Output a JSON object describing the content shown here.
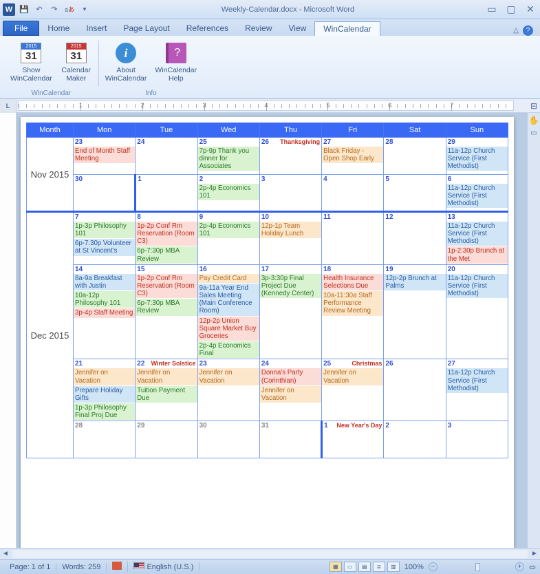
{
  "app": {
    "title": "Weekly-Calendar.docx - Microsoft Word"
  },
  "tabs": {
    "file": "File",
    "items": [
      "Home",
      "Insert",
      "Page Layout",
      "References",
      "Review",
      "View",
      "WinCalendar"
    ],
    "active": "WinCalendar"
  },
  "ribbon": {
    "group1_label": "WinCalendar",
    "btn_show": "Show\nWinCalendar",
    "btn_maker": "Calendar\nMaker",
    "group2_label": "Info",
    "btn_about": "About\nWinCalendar",
    "btn_help": "WinCalendar\nHelp"
  },
  "ruler": {
    "nums": [
      "1",
      "2",
      "3",
      "4",
      "5",
      "6",
      "7"
    ]
  },
  "cal_header": [
    "Month",
    "Mon",
    "Tue",
    "Wed",
    "Thu",
    "Fri",
    "Sat",
    "Sun"
  ],
  "months": {
    "m1": "Nov 2015",
    "m2": "Dec 2015"
  },
  "rows": [
    {
      "days": [
        {
          "n": "23",
          "cls": "",
          "evts": [
            {
              "c": "red",
              "t": "End of Month Staff Meeting"
            }
          ]
        },
        {
          "n": "24",
          "cls": "",
          "evts": []
        },
        {
          "n": "25",
          "cls": "",
          "evts": [
            {
              "c": "green",
              "t": "7p-9p Thank you dinner for Associates"
            }
          ]
        },
        {
          "n": "26",
          "cls": "",
          "hol": "Thanksgiving",
          "evts": []
        },
        {
          "n": "27",
          "cls": "",
          "evts": [
            {
              "c": "peach",
              "t": "Black Friday - Open Shop Early"
            }
          ]
        },
        {
          "n": "28",
          "cls": "",
          "evts": []
        },
        {
          "n": "29",
          "cls": "",
          "evts": [
            {
              "c": "blue",
              "t": "11a-12p Church Service (First Methodist)"
            }
          ]
        }
      ]
    },
    {
      "days": [
        {
          "n": "30",
          "cls": "",
          "evts": []
        },
        {
          "n": "1",
          "cls": "thick-left",
          "evts": []
        },
        {
          "n": "2",
          "cls": "",
          "evts": [
            {
              "c": "green",
              "t": "2p-4p Economics 101"
            }
          ]
        },
        {
          "n": "3",
          "cls": "",
          "evts": []
        },
        {
          "n": "4",
          "cls": "",
          "evts": []
        },
        {
          "n": "5",
          "cls": "",
          "evts": []
        },
        {
          "n": "6",
          "cls": "",
          "evts": [
            {
              "c": "blue",
              "t": "11a-12p Church Service (First Methodist)"
            }
          ]
        }
      ]
    },
    {
      "thick": true,
      "days": [
        {
          "n": "7",
          "cls": "",
          "evts": [
            {
              "c": "green",
              "t": "1p-3p Philosophy 101"
            },
            {
              "c": "blue",
              "t": "6p-7:30p Volunteer at St Vincent's"
            }
          ]
        },
        {
          "n": "8",
          "cls": "",
          "evts": [
            {
              "c": "red",
              "t": "1p-2p Conf Rm Reservation (Room C3)"
            },
            {
              "c": "green",
              "t": "6p-7:30p MBA Review"
            }
          ]
        },
        {
          "n": "9",
          "cls": "",
          "evts": [
            {
              "c": "green",
              "t": "2p-4p Economics 101"
            }
          ]
        },
        {
          "n": "10",
          "cls": "",
          "evts": [
            {
              "c": "peach",
              "t": "12p-1p Team Holiday Lunch"
            }
          ]
        },
        {
          "n": "11",
          "cls": "",
          "evts": []
        },
        {
          "n": "12",
          "cls": "",
          "evts": []
        },
        {
          "n": "13",
          "cls": "",
          "evts": [
            {
              "c": "blue",
              "t": "11a-12p Church Service (First Methodist)"
            },
            {
              "c": "red",
              "t": "1p-2:30p Brunch at the Met"
            }
          ]
        }
      ]
    },
    {
      "days": [
        {
          "n": "14",
          "cls": "",
          "evts": [
            {
              "c": "blue",
              "t": "8a-9a Breakfast with Justin"
            },
            {
              "c": "green",
              "t": "10a-12p Philosophy 101"
            },
            {
              "c": "red",
              "t": "3p-4p Staff Meeting"
            }
          ]
        },
        {
          "n": "15",
          "cls": "",
          "evts": [
            {
              "c": "red",
              "t": "1p-2p Conf Rm Reservation (Room C3)"
            },
            {
              "c": "green",
              "t": "6p-7:30p MBA Review"
            }
          ]
        },
        {
          "n": "16",
          "cls": "",
          "evts": [
            {
              "c": "peach",
              "t": "Pay Credit Card"
            },
            {
              "c": "blue",
              "t": "9a-11a Year End Sales Meeting (Main Conference Room)"
            },
            {
              "c": "red",
              "t": "12p-2p Union Square Market Buy Groceries"
            },
            {
              "c": "green",
              "t": "2p-4p Economics Final"
            }
          ]
        },
        {
          "n": "17",
          "cls": "",
          "evts": [
            {
              "c": "green",
              "t": "3p-3:30p Final Project Due (Kennedy Center)"
            }
          ]
        },
        {
          "n": "18",
          "cls": "",
          "evts": [
            {
              "c": "red",
              "t": "Health Insurance Selections Due"
            },
            {
              "c": "peach",
              "t": "10a-11:30a Staff Performance Review Meeting"
            }
          ]
        },
        {
          "n": "19",
          "cls": "",
          "evts": [
            {
              "c": "blue",
              "t": "12p-2p Brunch at Palms"
            }
          ]
        },
        {
          "n": "20",
          "cls": "",
          "evts": [
            {
              "c": "blue",
              "t": "11a-12p Church Service (First Methodist)"
            }
          ]
        }
      ]
    },
    {
      "days": [
        {
          "n": "21",
          "cls": "",
          "evts": [
            {
              "c": "peach",
              "t": "Jennifer on Vacation"
            },
            {
              "c": "blue",
              "t": "Prepare Holiday Gifts"
            },
            {
              "c": "green",
              "t": "1p-3p Philosophy Final Proj Due"
            }
          ]
        },
        {
          "n": "22",
          "cls": "",
          "hol": "Winter Solstice",
          "evts": [
            {
              "c": "peach",
              "t": "Jennifer on Vacation"
            },
            {
              "c": "green",
              "t": "Tuition Payment Due"
            }
          ]
        },
        {
          "n": "23",
          "cls": "",
          "evts": [
            {
              "c": "peach",
              "t": "Jennifer on Vacation"
            }
          ]
        },
        {
          "n": "24",
          "cls": "",
          "evts": [
            {
              "c": "red",
              "t": "Donna's Party (Corinthian)"
            },
            {
              "c": "peach",
              "t": "Jennifer on Vacation"
            }
          ]
        },
        {
          "n": "25",
          "cls": "",
          "hol": "Christmas",
          "evts": [
            {
              "c": "peach",
              "t": "Jennifer on Vacation"
            }
          ]
        },
        {
          "n": "26",
          "cls": "",
          "evts": []
        },
        {
          "n": "27",
          "cls": "",
          "evts": [
            {
              "c": "blue",
              "t": "11a-12p Church Service (First Methodist)"
            }
          ]
        }
      ]
    },
    {
      "days": [
        {
          "n": "28",
          "cls": "grey",
          "evts": []
        },
        {
          "n": "29",
          "cls": "grey",
          "evts": []
        },
        {
          "n": "30",
          "cls": "grey",
          "evts": []
        },
        {
          "n": "31",
          "cls": "grey",
          "evts": []
        },
        {
          "n": "1",
          "cls": "thick-left",
          "hol": "New Year's Day",
          "evts": []
        },
        {
          "n": "2",
          "cls": "",
          "evts": []
        },
        {
          "n": "3",
          "cls": "",
          "evts": []
        }
      ]
    }
  ],
  "status": {
    "page": "Page: 1 of 1",
    "words": "Words: 259",
    "lang": "English (U.S.)",
    "zoom": "100%"
  }
}
